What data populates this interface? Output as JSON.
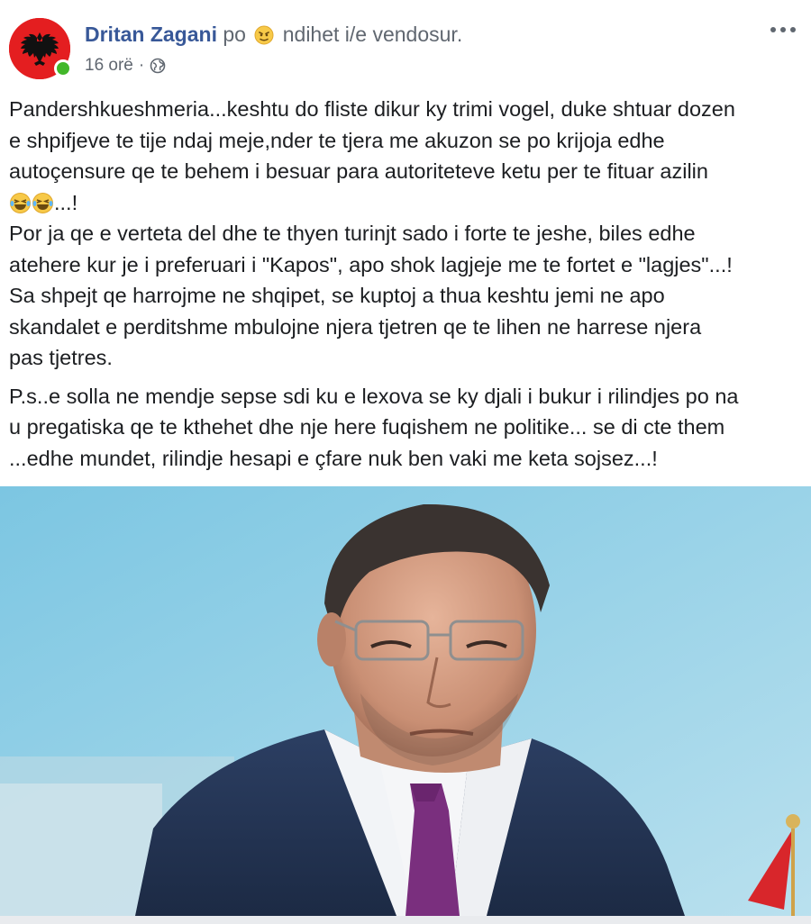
{
  "post": {
    "author_name": "Dritan Zagani",
    "feeling_prefix": "po",
    "feeling_text": "ndihet i/e vendosur.",
    "timestamp": "16 orë",
    "separator": "·",
    "privacy_icon": "globe-icon",
    "more_icon": "more-options-icon",
    "paragraphs": [
      {
        "lines": [
          "Pandershkueshmeria...keshtu do fliste dikur ky trimi vogel, duke shtuar dozen",
          "e shpifjeve te tije ndaj meje,nder te tjera me akuzon se po krijoja edhe",
          "autoçensure qe te behem i besuar para autoriteteve ketu per te fituar azilin"
        ],
        "emoji_suffix": "...!",
        "lines_after": [
          "Por ja qe e verteta del dhe te thyen turinjt sado i forte te jeshe, biles edhe",
          "atehere kur je i preferuari i \"Kapos\", apo shok lagjeje me te fortet e \"lagjes\"...!",
          "Sa shpejt qe harrojme ne shqipet, se kuptoj a thua keshtu jemi ne apo",
          "skandalet e perditshme mbulojne njera tjetren qe te lihen ne harrese njera",
          "pas tjetres."
        ]
      },
      {
        "lines": [
          "P.s..e solla ne mendje sepse sdi ku e lexova se ky djali i bukur i rilindjes po na",
          "u pregatiska qe te kthehet dhe nje here fuqishem ne politike... se di cte them",
          "...edhe mundet, rilindje hesapi e çfare nuk ben vaki me keta sojsez...!"
        ]
      }
    ],
    "colors": {
      "author_blue": "#385898",
      "meta_gray": "#606770",
      "text": "#1c1e21",
      "online_green": "#42b72a",
      "avatar_red": "#e41e20",
      "photo_bg": "#8ccbe2"
    }
  }
}
